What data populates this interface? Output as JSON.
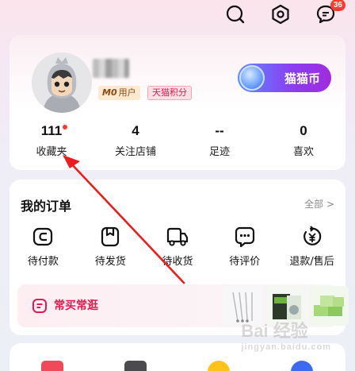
{
  "top_bar": {
    "messages_badge": "36"
  },
  "profile": {
    "member_tag_level": "M0",
    "member_tag_text": "用户",
    "tmall_points_tag": "天猫积分",
    "coin_button_label": "猫猫币"
  },
  "stats": [
    {
      "value": "111",
      "label": "收藏夹"
    },
    {
      "value": "4",
      "label": "关注店铺"
    },
    {
      "value": "--",
      "label": "足迹"
    },
    {
      "value": "0",
      "label": "喜欢"
    }
  ],
  "orders": {
    "title": "我的订单",
    "all_link": "全部 >",
    "items": [
      {
        "label": "待付款",
        "icon": "wallet-icon"
      },
      {
        "label": "待发货",
        "icon": "package-icon"
      },
      {
        "label": "待收货",
        "icon": "truck-icon"
      },
      {
        "label": "待评价",
        "icon": "comment-icon"
      },
      {
        "label": "退款/售后",
        "icon": "refund-icon"
      }
    ],
    "often_label": "常买常逛"
  },
  "watermark": {
    "main": "Bai 经验",
    "sub": "jingyan.baidu.com"
  },
  "colors": {
    "accent_red": "#e5194f",
    "badge_red": "#ff3b30",
    "coin_purple": "#8b3cf0"
  }
}
